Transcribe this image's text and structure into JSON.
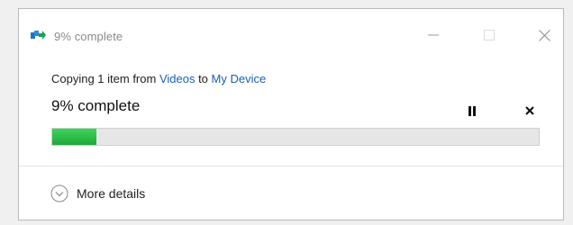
{
  "window": {
    "title": "9% complete",
    "icon": "file-copy-icon",
    "controls": {
      "minimize": "minimize-icon",
      "maximize": "maximize-icon",
      "close": "close-icon"
    }
  },
  "copy": {
    "prefix": "Copying 1 item from ",
    "source": "Videos",
    "middle": " to ",
    "destination": "My Device",
    "status": "9% complete",
    "progress_percent": 9
  },
  "actions": {
    "pause_icon": "pause-icon",
    "cancel_icon": "cancel-icon"
  },
  "footer": {
    "more_details_label": "More details",
    "expand_icon": "chevron-down-icon"
  },
  "colors": {
    "link": "#1a5fb4",
    "progress_fill": "#2bbf45",
    "progress_track": "#e6e6e6",
    "title_text": "#8a8a8a"
  }
}
